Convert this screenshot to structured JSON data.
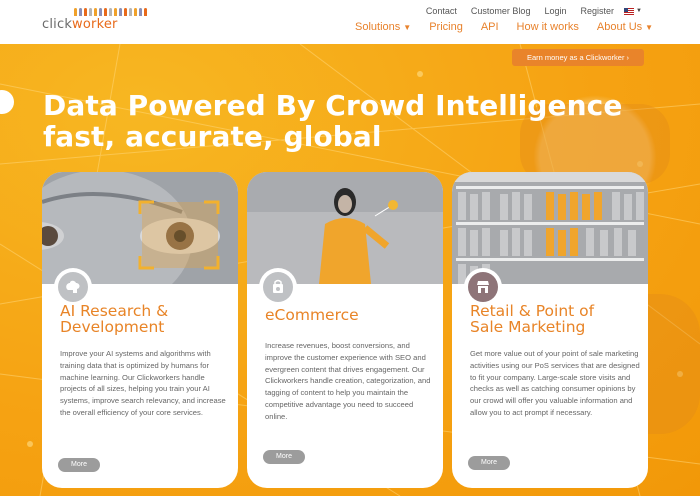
{
  "brand": {
    "logo_text_1": "click",
    "logo_text_2": "worker"
  },
  "top_nav": {
    "contact": "Contact",
    "blog": "Customer Blog",
    "login": "Login",
    "register": "Register"
  },
  "main_nav": {
    "solutions": "Solutions",
    "pricing": "Pricing",
    "api": "API",
    "how": "How it works",
    "about": "About Us"
  },
  "hero": {
    "earn_button": "Earn money as a Clickworker ›",
    "title_line1": "Data Powered By Crowd Intelligence",
    "title_line2": "fast, accurate, global"
  },
  "cards": [
    {
      "title_line1": "AI Research &",
      "title_line2": "Development",
      "body": "Improve your AI systems and algorithms with training data that is optimized by humans for machine learning. Our Clickworkers handle projects of all sizes, helping you train your AI systems, improve search relevancy, and increase the overall efficiency of your core services.",
      "more": "More",
      "icon": "brain-icon"
    },
    {
      "title_line1": "eCommerce",
      "title_line2": "",
      "body": "Increase revenues, boost conversions, and improve the customer experience with SEO and evergreen content that drives engagement. Our Clickworkers handle creation, categorization, and tagging of content to help you maintain the competitive advantage you need to succeed online.",
      "more": "More",
      "icon": "shopping-bag-icon"
    },
    {
      "title_line1": "Retail & Point of",
      "title_line2": "Sale Marketing",
      "body": "Get more value out of your point of sale marketing activities using our PoS services that are designed to fit your company. Large-scale store visits and checks as well as catching consumer opinions by our crowd will offer you valuable information and allow you to act prompt if necessary.",
      "more": "More",
      "icon": "storefront-icon"
    }
  ],
  "colors": {
    "accent": "#e8822c",
    "hero_bg": "#f6a313",
    "button_gray": "#9c9c9c"
  }
}
